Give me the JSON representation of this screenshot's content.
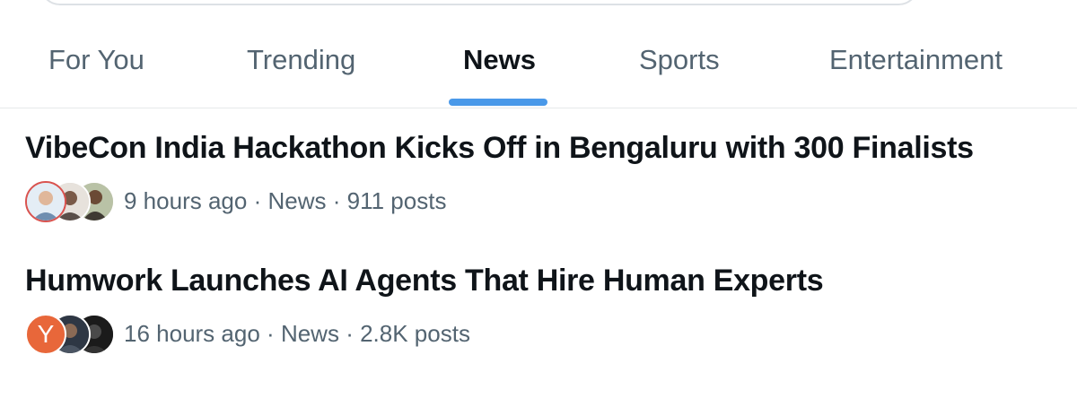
{
  "tabs": [
    {
      "label": "For You",
      "active": false
    },
    {
      "label": "Trending",
      "active": false
    },
    {
      "label": "News",
      "active": true
    },
    {
      "label": "Sports",
      "active": false
    },
    {
      "label": "Entertainment",
      "active": false
    }
  ],
  "trends": [
    {
      "title": "VibeCon India Hackathon Kicks Off in Bengaluru with 300 Finalists",
      "time": "9 hours ago",
      "category": "News",
      "posts": "911 posts",
      "avatars": [
        "user-avatar",
        "user-avatar",
        "user-avatar"
      ]
    },
    {
      "title": "Humwork Launches AI Agents That Hire Human Experts",
      "time": "16 hours ago",
      "category": "News",
      "posts": "2.8K posts",
      "avatars": [
        "y-logo-avatar",
        "user-avatar",
        "user-avatar"
      ],
      "logo_letter": "Y"
    }
  ],
  "separator": "·",
  "colors": {
    "accent": "#4a99e9",
    "text_primary": "#0f1419",
    "text_secondary": "#536471",
    "y_logo": "#e8673a"
  }
}
